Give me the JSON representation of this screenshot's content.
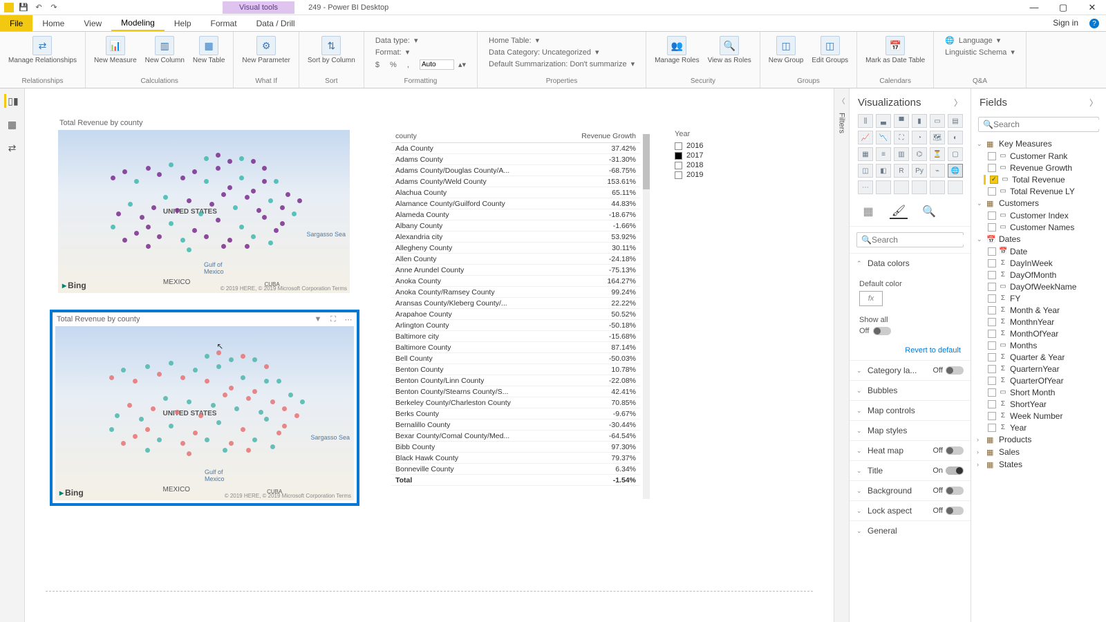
{
  "titlebar": {
    "doc_title": "249 - Power BI Desktop",
    "visual_tools": "Visual tools",
    "signin": "Sign in"
  },
  "tabs": {
    "file": "File",
    "home": "Home",
    "view": "View",
    "modeling": "Modeling",
    "help": "Help",
    "format": "Format",
    "datadrill": "Data / Drill"
  },
  "ribbon": {
    "relationships": {
      "manage": "Manage\nRelationships",
      "group": "Relationships"
    },
    "calc": {
      "measure": "New\nMeasure",
      "column": "New\nColumn",
      "table": "New\nTable",
      "group": "Calculations"
    },
    "whatif": {
      "param": "New\nParameter",
      "group": "What If"
    },
    "sort": {
      "sortby": "Sort by\nColumn",
      "group": "Sort"
    },
    "formatting": {
      "datatype": "Data type:",
      "format": "Format:",
      "currency": "$",
      "pct": "%",
      "comma": ",",
      "auto": "Auto",
      "group": "Formatting"
    },
    "properties": {
      "hometable": "Home Table:",
      "datacat": "Data Category: Uncategorized",
      "summ": "Default Summarization: Don't summarize",
      "group": "Properties"
    },
    "security": {
      "manage": "Manage\nRoles",
      "viewas": "View as\nRoles",
      "group": "Security"
    },
    "groupsg": {
      "new": "New\nGroup",
      "edit": "Edit\nGroups",
      "group": "Groups"
    },
    "calendars": {
      "mark": "Mark as\nDate Table",
      "group": "Calendars"
    },
    "qa": {
      "lang": "Language",
      "ling": "Linguistic Schema",
      "group": "Q&A"
    }
  },
  "canvas": {
    "map_title": "Total Revenue by county",
    "bing": "Bing",
    "credits": "© 2019 HERE, © 2019 Microsoft Corporation  Terms",
    "us": "UNITED STATES",
    "mexico": "MEXICO",
    "cuba": "CUBA",
    "gulf": "Gulf of\nMexico",
    "sargasso": "Sargasso Sea"
  },
  "table": {
    "col1": "county",
    "col2": "Revenue Growth",
    "rows": [
      [
        "Ada County",
        "37.42%"
      ],
      [
        "Adams County",
        "-31.30%"
      ],
      [
        "Adams County/Douglas County/A...",
        "-68.75%"
      ],
      [
        "Adams County/Weld County",
        "153.61%"
      ],
      [
        "Alachua County",
        "65.11%"
      ],
      [
        "Alamance County/Guilford County",
        "44.83%"
      ],
      [
        "Alameda County",
        "-18.67%"
      ],
      [
        "Albany County",
        "-1.66%"
      ],
      [
        "Alexandria city",
        "53.92%"
      ],
      [
        "Allegheny County",
        "30.11%"
      ],
      [
        "Allen County",
        "-24.18%"
      ],
      [
        "Anne Arundel County",
        "-75.13%"
      ],
      [
        "Anoka County",
        "164.27%"
      ],
      [
        "Anoka County/Ramsey County",
        "99.24%"
      ],
      [
        "Aransas County/Kleberg County/...",
        "22.22%"
      ],
      [
        "Arapahoe County",
        "50.52%"
      ],
      [
        "Arlington County",
        "-50.18%"
      ],
      [
        "Baltimore city",
        "-15.68%"
      ],
      [
        "Baltimore County",
        "87.14%"
      ],
      [
        "Bell County",
        "-50.03%"
      ],
      [
        "Benton County",
        "10.78%"
      ],
      [
        "Benton County/Linn County",
        "-22.08%"
      ],
      [
        "Benton County/Stearns County/S...",
        "42.41%"
      ],
      [
        "Berkeley County/Charleston County",
        "70.85%"
      ],
      [
        "Berks County",
        "-9.67%"
      ],
      [
        "Bernalillo County",
        "-30.44%"
      ],
      [
        "Bexar County/Comal County/Med...",
        "-64.54%"
      ],
      [
        "Bibb County",
        "97.30%"
      ],
      [
        "Black Hawk County",
        "79.37%"
      ],
      [
        "Bonneville County",
        "6.34%"
      ]
    ],
    "total_label": "Total",
    "total_val": "-1.54%"
  },
  "slicer": {
    "header": "Year",
    "items": [
      {
        "label": "2016",
        "sel": false
      },
      {
        "label": "2017",
        "sel": true
      },
      {
        "label": "2018",
        "sel": false
      },
      {
        "label": "2019",
        "sel": false
      }
    ]
  },
  "filters_label": "Filters",
  "vis": {
    "title": "Visualizations",
    "search_ph": "Search",
    "sections": {
      "datacolors": "Data colors",
      "default_color": "Default color",
      "showall": "Show all",
      "off": "Off",
      "on": "On",
      "revert": "Revert to default",
      "catlabels": "Category la...",
      "bubbles": "Bubbles",
      "mapcontrols": "Map controls",
      "mapstyles": "Map styles",
      "heatmap": "Heat map",
      "titlef": "Title",
      "background": "Background",
      "lockaspect": "Lock aspect",
      "general": "General"
    }
  },
  "fields": {
    "title": "Fields",
    "search_ph": "Search",
    "key_measures": {
      "name": "Key Measures",
      "items": [
        "Customer Rank",
        "Revenue Growth",
        "Total Revenue",
        "Total Revenue LY"
      ],
      "checked": [
        false,
        false,
        true,
        false
      ]
    },
    "customers": {
      "name": "Customers",
      "items": [
        "Customer Index",
        "Customer Names"
      ]
    },
    "dates": {
      "name": "Dates",
      "items": [
        "Date",
        "DayInWeek",
        "DayOfMonth",
        "DayOfWeekName",
        "FY",
        "Month & Year",
        "MonthnYear",
        "MonthOfYear",
        "Months",
        "Quarter & Year",
        "QuarternYear",
        "QuarterOfYear",
        "Short Month",
        "ShortYear",
        "Week Number",
        "Year"
      ]
    },
    "products": {
      "name": "Products"
    },
    "sales": {
      "name": "Sales"
    },
    "states": {
      "name": "States"
    }
  }
}
